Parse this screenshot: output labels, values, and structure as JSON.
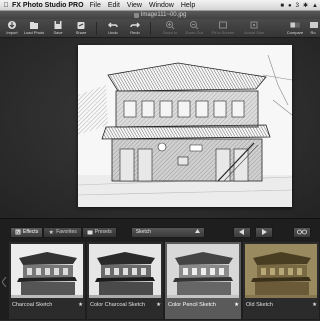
{
  "menubar": {
    "apple_icon": "apple-icon",
    "app_name": "FX Photo Studio PRO",
    "menus": [
      "File",
      "Edit",
      "View",
      "Window",
      "Help"
    ],
    "status_number": "3"
  },
  "window": {
    "title": "Image111~00.jpg"
  },
  "toolbar": {
    "import": "Import",
    "load_photo": "Load Photo",
    "save": "Save",
    "share": "Share",
    "undo": "Undo",
    "redo": "Redo",
    "zoom_in": "Zoom In",
    "zoom_out": "Zoom Out",
    "fit_to_screen": "Fit to Screen",
    "actual_size": "Actual Size",
    "compare": "Compare",
    "rotate": "Ro"
  },
  "effects": {
    "tabs": [
      "Effects",
      "Favorites",
      "Presets"
    ],
    "category": "Sketch",
    "thumbnails": [
      {
        "label": "Charcoal Sketch",
        "tone": "#ececec"
      },
      {
        "label": "Color Charcoal Sketch",
        "tone": "#e6e6e6"
      },
      {
        "label": "Color Pencil Sketch",
        "tone": "#d8d8d8"
      },
      {
        "label": "Old Sketch",
        "tone": "#9a8a60"
      }
    ]
  },
  "colors": {
    "workspace": "#2d2d2d",
    "panel": "#1e1e1e",
    "selected_thumb": "#5a5a5a"
  }
}
